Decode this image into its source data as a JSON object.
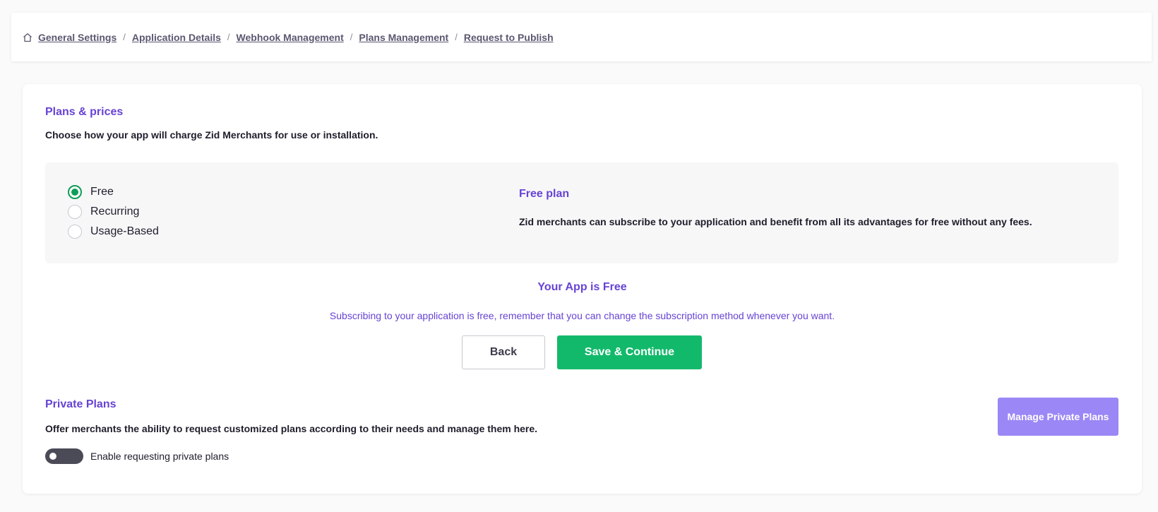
{
  "breadcrumb": {
    "home_icon": "home-icon",
    "items": [
      {
        "label": "General Settings"
      },
      {
        "label": "Application Details"
      },
      {
        "label": "Webhook Management"
      },
      {
        "label": "Plans Management"
      },
      {
        "label": "Request to Publish"
      }
    ],
    "separator": "/"
  },
  "plans": {
    "title": "Plans & prices",
    "description": "Choose how your app will charge Zid Merchants for use or installation.",
    "options": [
      {
        "label": "Free",
        "checked": true
      },
      {
        "label": "Recurring",
        "checked": false
      },
      {
        "label": "Usage-Based",
        "checked": false
      }
    ],
    "selected_info": {
      "title": "Free plan",
      "description": "Zid merchants can subscribe to your application and benefit from all its advantages for free without any fees."
    }
  },
  "free_notice": {
    "title": "Your App is Free",
    "description": "Subscribing to your application is free, remember that you can change the subscription method whenever you want."
  },
  "actions": {
    "back_label": "Back",
    "save_label": "Save & Continue"
  },
  "private_plans": {
    "title": "Private Plans",
    "description": "Offer merchants the ability to request customized plans according to their needs and manage them here.",
    "manage_label": "Manage Private Plans",
    "toggle_label": "Enable requesting private plans",
    "toggle_enabled": false
  },
  "colors": {
    "accent": "#6743d4",
    "primary_button": "#13b96b",
    "secondary_button": "#9b87f5",
    "radio_checked": "#0f9d58"
  }
}
